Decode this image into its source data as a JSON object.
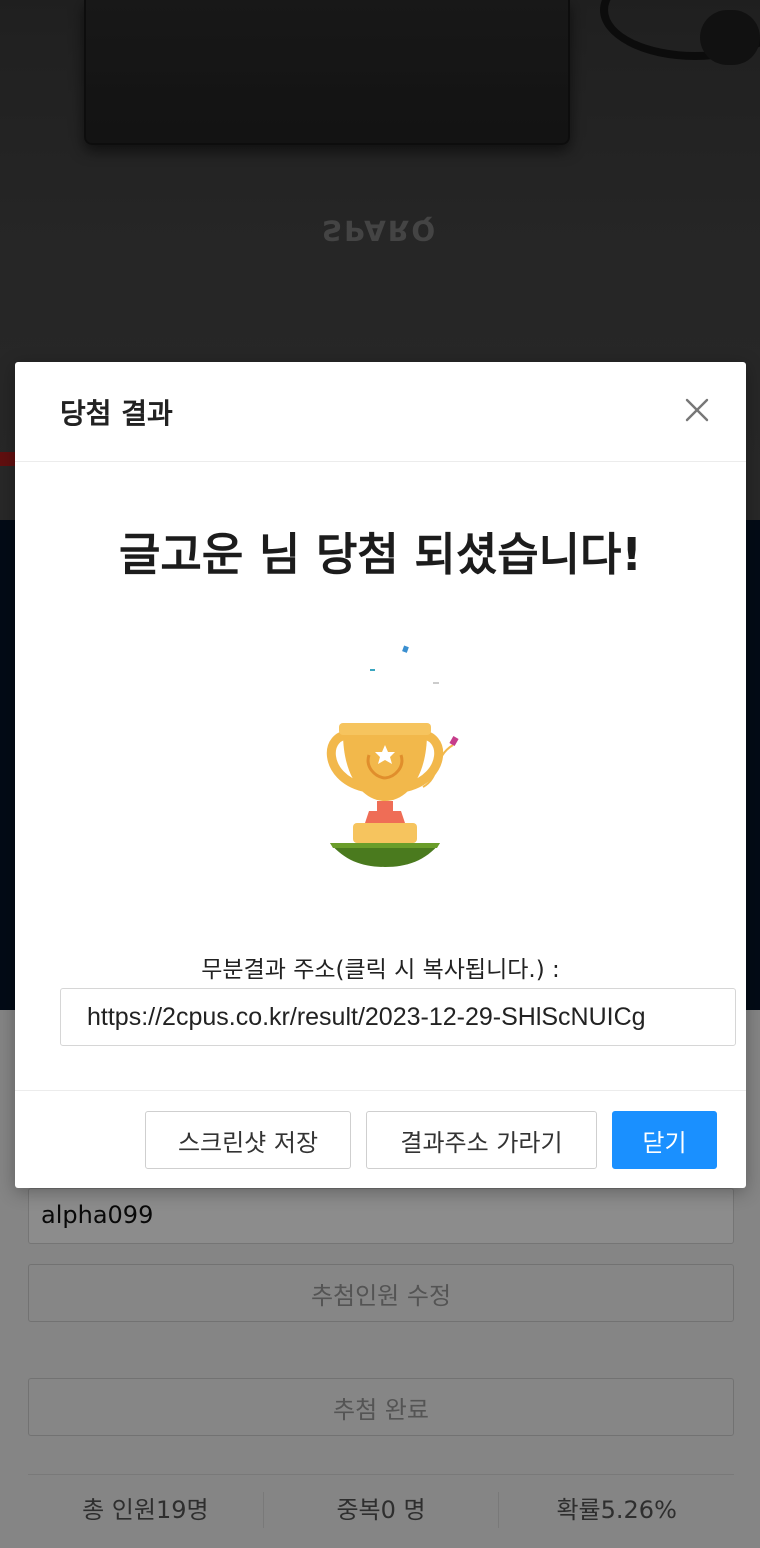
{
  "background": {
    "photo_brand_text": "SPARQ",
    "form": {
      "user_id_value": "alpha099",
      "edit_button_label": "추첨인원 수정",
      "done_button_label": "추첨 완료",
      "stats": [
        {
          "label": "총 인원19명"
        },
        {
          "label": "중복0 명"
        },
        {
          "label": "확률5.26%"
        }
      ]
    }
  },
  "modal": {
    "title": "당첨 결과",
    "headline": "글고운 님 당첨 되셨습니다!",
    "illustration": "trophy-icon",
    "link_label": "무분결과 주소(클릭 시 복사됩니다.) :",
    "link_value": "https://2cpus.co.kr/result/2023-12-29-SHlScNUICg",
    "buttons": {
      "save_screenshot": "스크린샷 저장",
      "hide_link": "결과주소 가라기",
      "close": "닫기"
    },
    "colors": {
      "primary": "#1a90ff",
      "trophy_gold": "#f2b84b",
      "grass": "#4a7a1e"
    }
  }
}
